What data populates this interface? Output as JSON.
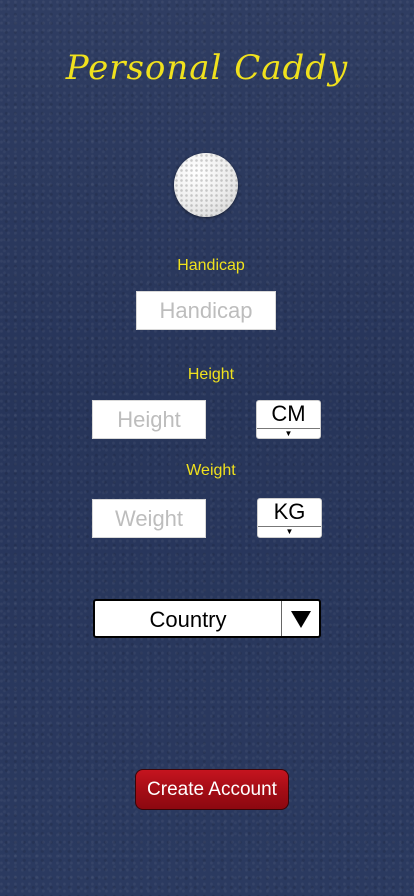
{
  "app": {
    "title": "Personal Caddy"
  },
  "handicap": {
    "label": "Handicap",
    "placeholder": "Handicap",
    "value": ""
  },
  "height": {
    "label": "Height",
    "placeholder": "Height",
    "value": "",
    "unit": "CM",
    "caret": "▼"
  },
  "weight": {
    "label": "Weight",
    "placeholder": "Weight",
    "value": "",
    "unit": "KG",
    "caret": "▼"
  },
  "country": {
    "label": "Country"
  },
  "actions": {
    "create_account": "Create Account"
  },
  "icons": {
    "logo": "golf-ball-icon",
    "country_dropdown": "triangle-down-icon",
    "unit_dropdown": "caret-down-icon"
  },
  "colors": {
    "background": "#2c3a5e",
    "accent_text": "#f0e11d",
    "button": "#a50d16",
    "button_text": "#ffffff"
  }
}
